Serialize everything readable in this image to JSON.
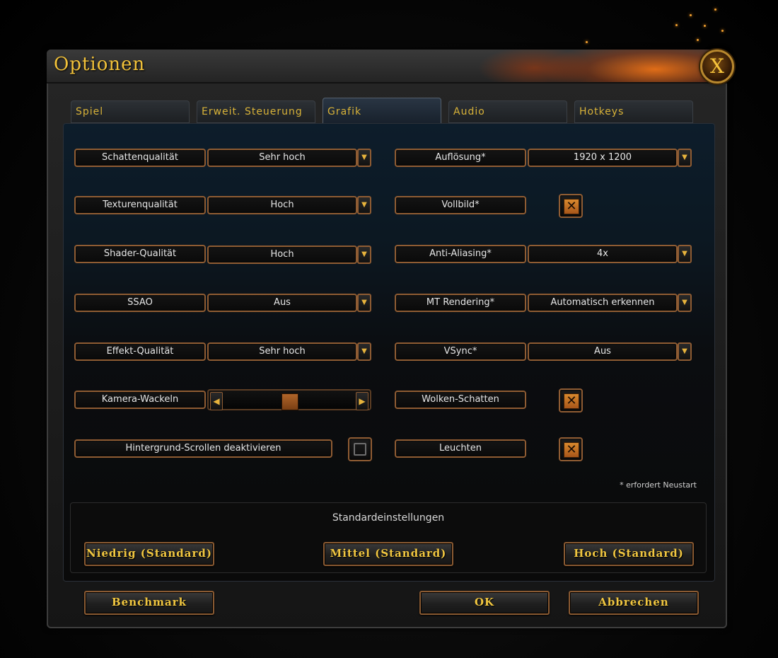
{
  "window": {
    "title": "Optionen",
    "close_label": "X"
  },
  "tabs": [
    {
      "label": "Spiel",
      "active": false
    },
    {
      "label": "Erweit. Steuerung",
      "active": false
    },
    {
      "label": "Grafik",
      "active": true
    },
    {
      "label": "Audio",
      "active": false
    },
    {
      "label": "Hotkeys",
      "active": false
    }
  ],
  "left_options": [
    {
      "label": "Schattenqualität",
      "value": "Sehr hoch"
    },
    {
      "label": "Texturenqualität",
      "value": "Hoch"
    },
    {
      "label": "Shader-Qualität",
      "value": "Hoch"
    },
    {
      "label": "SSAO",
      "value": "Aus"
    },
    {
      "label": "Effekt-Qualität",
      "value": "Sehr hoch"
    }
  ],
  "camera_shake": {
    "label": "Kamera-Wackeln",
    "level_fraction": 0.5
  },
  "background_scroll": {
    "label": "Hintergrund-Scrollen deaktivieren",
    "checked": false
  },
  "right_options": {
    "resolution": {
      "label": "Auflösung*",
      "value": "1920 x 1200"
    },
    "fullscreen": {
      "label": "Vollbild*",
      "checked": true
    },
    "anti_aliasing": {
      "label": "Anti-Aliasing*",
      "value": "4x"
    },
    "mt_rendering": {
      "label": "MT Rendering*",
      "value": "Automatisch erkennen"
    },
    "vsync": {
      "label": "VSync*",
      "value": "Aus"
    },
    "cloud_shadows": {
      "label": "Wolken-Schatten",
      "checked": true
    },
    "glow": {
      "label": "Leuchten",
      "checked": true
    }
  },
  "restart_note": "* erfordert Neustart",
  "presets": {
    "title": "Standardeinstellungen",
    "low": "Niedrig (Standard)",
    "medium": "Mittel (Standard)",
    "high": "Hoch (Standard)"
  },
  "footer": {
    "benchmark": "Benchmark",
    "ok": "OK",
    "cancel": "Abbrechen"
  },
  "icons": {
    "dropdown": "dropdown-arrow-icon",
    "checkmark": "x-check-icon"
  },
  "colors": {
    "accent_gold": "#f0c640",
    "border_copper": "#8f5c33",
    "check_orange": "#d9892e"
  }
}
